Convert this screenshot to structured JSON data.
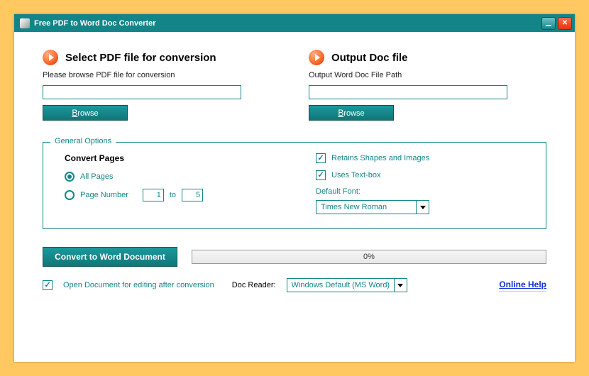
{
  "title": "Free PDF to Word Doc Converter",
  "input": {
    "heading": "Select PDF file for conversion",
    "sub": "Please browse PDF file for conversion",
    "path": "",
    "browse": "Browse"
  },
  "output": {
    "heading": "Output Doc file",
    "sub": "Output Word Doc File Path",
    "path": "",
    "browse": "Browse"
  },
  "options": {
    "legend": "General Options",
    "convert_pages_title": "Convert Pages",
    "all_pages": "All Pages",
    "page_number": "Page Number",
    "from": "1",
    "to_label": "to",
    "to": "5",
    "retains": "Retains Shapes and Images",
    "textbox": "Uses Text-box",
    "default_font_label": "Default Font:",
    "font": "Times New Roman"
  },
  "convert_btn": "Convert to Word Document",
  "progress": "0%",
  "open_after": "Open Document for editing after conversion",
  "doc_reader_label": "Doc Reader:",
  "doc_reader": "Windows Default (MS Word)",
  "help": "Online Help"
}
